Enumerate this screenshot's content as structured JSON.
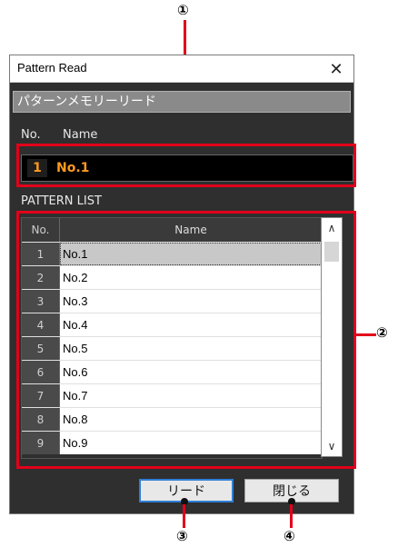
{
  "window": {
    "title": "Pattern Read",
    "close_label": "✕"
  },
  "header_bar": {
    "text": "パターンメモリーリード"
  },
  "current": {
    "no_label": "No.",
    "name_label": "Name",
    "number": "1",
    "name": "No.1"
  },
  "list": {
    "title": "PATTERN LIST",
    "columns": [
      "No.",
      "Name"
    ],
    "rows": [
      {
        "no": "1",
        "name": "No.1"
      },
      {
        "no": "2",
        "name": "No.2"
      },
      {
        "no": "3",
        "name": "No.3"
      },
      {
        "no": "4",
        "name": "No.4"
      },
      {
        "no": "5",
        "name": "No.5"
      },
      {
        "no": "6",
        "name": "No.6"
      },
      {
        "no": "7",
        "name": "No.7"
      },
      {
        "no": "8",
        "name": "No.8"
      },
      {
        "no": "9",
        "name": "No.9"
      }
    ],
    "selected_index": 0
  },
  "scroll": {
    "up": "∧",
    "down": "∨"
  },
  "buttons": {
    "read": "リード",
    "close": "閉じる"
  },
  "callouts": {
    "c1": "①",
    "c2": "②",
    "c3": "③",
    "c4": "④"
  },
  "colors": {
    "highlight": "#e2001a",
    "accent_text": "#ff9a1e",
    "dialog_bg": "#2f2f2f"
  }
}
